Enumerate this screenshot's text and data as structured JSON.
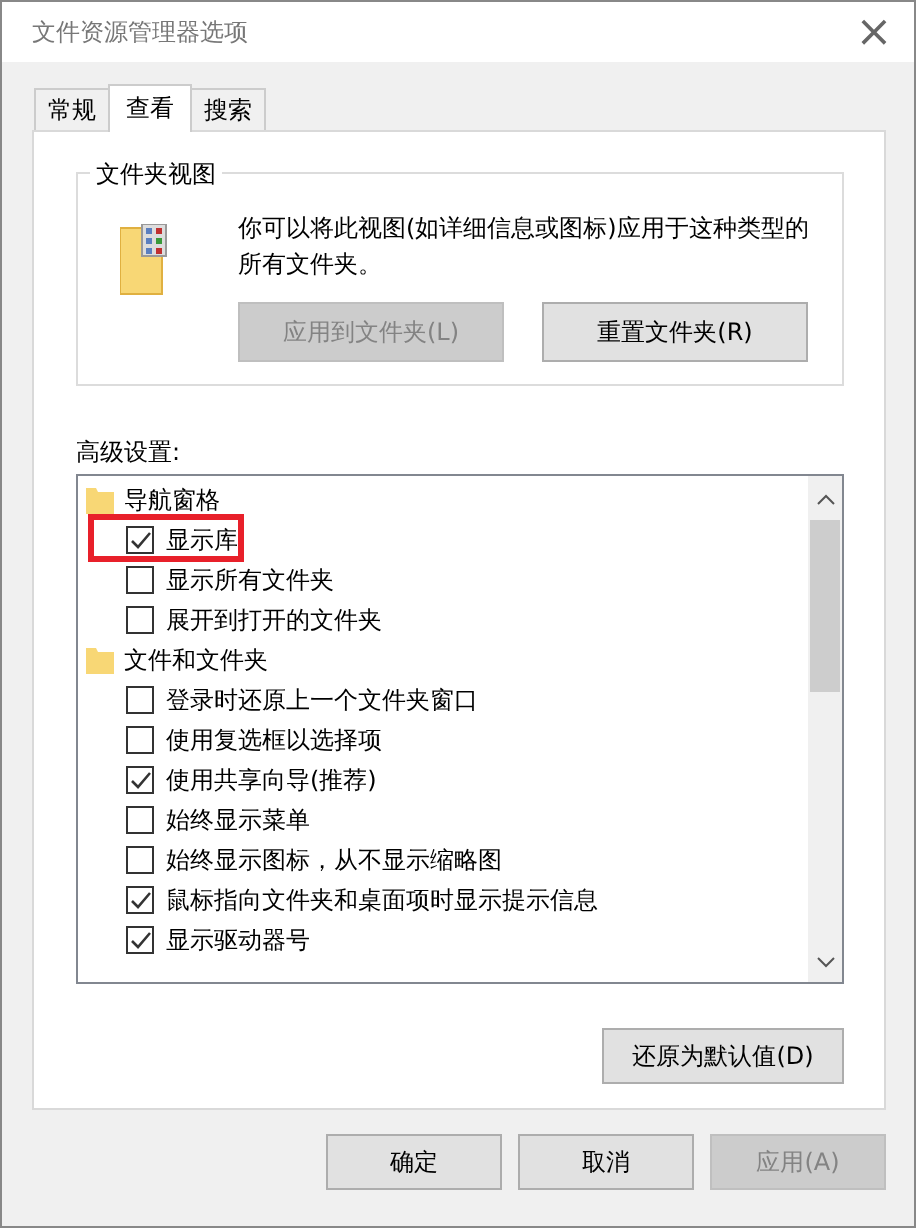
{
  "window": {
    "title": "文件资源管理器选项",
    "close": "×"
  },
  "tabs": [
    {
      "label": "常规",
      "selected": false
    },
    {
      "label": "查看",
      "selected": true
    },
    {
      "label": "搜索",
      "selected": false
    }
  ],
  "folder_views": {
    "title": "文件夹视图",
    "description": "你可以将此视图(如详细信息或图标)应用于这种类型的所有文件夹。",
    "buttons": [
      {
        "label": "应用到文件夹(L)",
        "disabled": true
      },
      {
        "label": "重置文件夹(R)",
        "disabled": false
      }
    ]
  },
  "advanced": {
    "label": "高级设置:",
    "tree": [
      {
        "label": "导航窗格",
        "children": [
          {
            "label": "显示库",
            "checked": true,
            "highlighted": true
          },
          {
            "label": "显示所有文件夹",
            "checked": false,
            "highlighted": false
          },
          {
            "label": "展开到打开的文件夹",
            "checked": false,
            "highlighted": false
          }
        ]
      },
      {
        "label": "文件和文件夹",
        "children": [
          {
            "label": "登录时还原上一个文件夹窗口",
            "checked": false,
            "highlighted": false
          },
          {
            "label": "使用复选框以选择项",
            "checked": false,
            "highlighted": false
          },
          {
            "label": "使用共享向导(推荐)",
            "checked": true,
            "highlighted": false
          },
          {
            "label": "始终显示菜单",
            "checked": false,
            "highlighted": false
          },
          {
            "label": "始终显示图标，从不显示缩略图",
            "checked": false,
            "highlighted": false
          },
          {
            "label": "鼠标指向文件夹和桌面项时显示提示信息",
            "checked": true,
            "highlighted": false
          },
          {
            "label": "显示驱动器号",
            "checked": true,
            "highlighted": false
          }
        ]
      }
    ],
    "restore_button": "还原为默认值(D)"
  },
  "buttons": [
    {
      "label": "确定",
      "disabled": false
    },
    {
      "label": "取消",
      "disabled": false
    },
    {
      "label": "应用(A)",
      "disabled": true
    }
  ]
}
